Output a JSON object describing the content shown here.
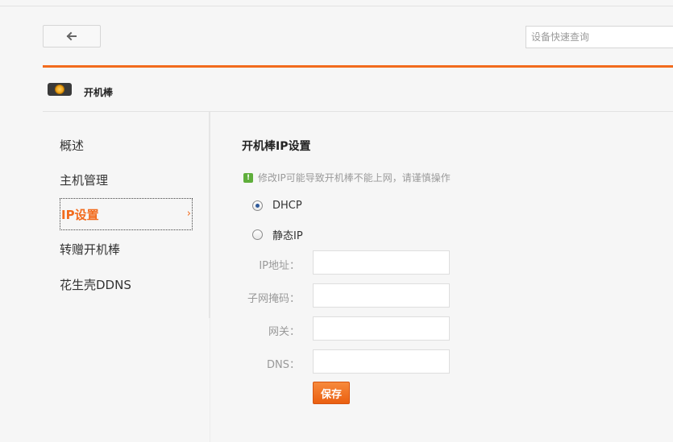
{
  "header": {
    "search_placeholder": "设备快速查询"
  },
  "device": {
    "name": "开机棒"
  },
  "sidebar": {
    "items": [
      {
        "label": "概述"
      },
      {
        "label": "主机管理"
      },
      {
        "label": "IP设置",
        "active": true
      },
      {
        "label": "转赠开机棒"
      },
      {
        "label": "花生壳DDNS"
      }
    ],
    "active_chevron": "›"
  },
  "main": {
    "title": "开机棒IP设置",
    "warning": "修改IP可能导致开机棒不能上网，请谨慎操作",
    "options": {
      "dhcp": "DHCP",
      "static": "静态IP",
      "selected": "DHCP"
    },
    "fields": {
      "ip_label": "IP地址：",
      "mask_label": "子网掩码：",
      "gateway_label": "网关：",
      "dns_label": "DNS：",
      "ip_value": "",
      "mask_value": "",
      "gateway_value": "",
      "dns_value": ""
    },
    "save_label": "保存"
  },
  "colors": {
    "accent": "#f26b1d",
    "warning_icon": "#5fae3b"
  },
  "icons": {
    "back": "back-arrow-icon",
    "device": "device-icon",
    "warning": "warning-icon"
  }
}
